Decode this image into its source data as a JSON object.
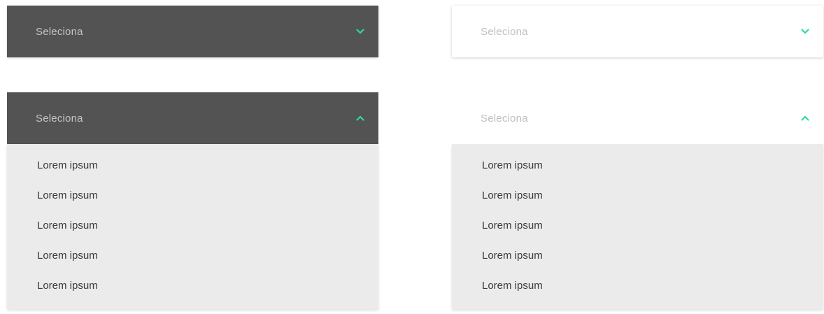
{
  "accent_color": "#2ed8a3",
  "dark_closed": {
    "label": "Seleciona",
    "icon": "chevron-down-icon"
  },
  "light_closed": {
    "label": "Seleciona",
    "icon": "chevron-down-icon"
  },
  "dark_open": {
    "label": "Seleciona",
    "icon": "chevron-up-icon",
    "options": [
      "Lorem ipsum",
      "Lorem ipsum",
      "Lorem ipsum",
      "Lorem ipsum",
      "Lorem ipsum"
    ]
  },
  "light_open": {
    "label": "Seleciona",
    "icon": "chevron-up-icon",
    "options": [
      "Lorem ipsum",
      "Lorem ipsum",
      "Lorem ipsum",
      "Lorem ipsum",
      "Lorem ipsum"
    ]
  }
}
